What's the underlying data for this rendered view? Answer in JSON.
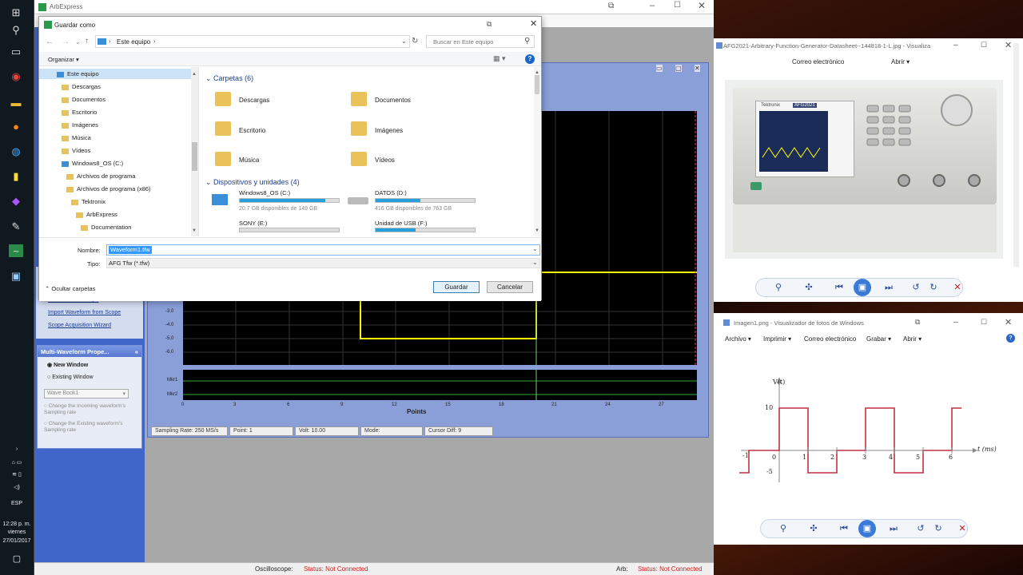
{
  "taskbar": {
    "icons": [
      "windows-icon",
      "search-icon",
      "task-view-icon",
      "chrome-icon",
      "file-explorer-icon",
      "firefox-icon",
      "app-icon",
      "notes-icon",
      "visual-studio-icon",
      "pen-icon",
      "arbexpress-icon",
      "photo-viewer-icon"
    ],
    "tray_lang": "ESP",
    "time": "12:28 p. m.",
    "day": "viernes",
    "date": "27/01/2017"
  },
  "arb": {
    "title": "ArbExpress",
    "links": [
      "Import Waveform from Scope",
      "Scope Acquisition Wizard"
    ],
    "partial_link": "Link an Arb & Scope",
    "mw_panel": {
      "title": "Multi-Waveform Prope...",
      "new_window": "New Window",
      "existing_window": "Existing Window",
      "select_value": "Wave Book1",
      "opt1": "Change the Incoming waveform's Sampling rate",
      "opt2": "Change the Existing waveform's Sampling rate"
    },
    "graph": {
      "x_label": "Points",
      "x_ticks": [
        "0",
        "3",
        "6",
        "9",
        "12",
        "15",
        "18",
        "21",
        "24",
        "27"
      ],
      "y_ticks": [
        "-3.0",
        "-4.0",
        "-5.0",
        "-6.0"
      ],
      "mkr_labels": [
        "Mkr1",
        "Mkr2"
      ]
    },
    "status_fields": [
      "Sampling Rate: 250 MS/s",
      "Point: 1",
      "Volt: 10.00",
      "Mode:",
      "Cursor Diff: 9"
    ],
    "bottom": {
      "osc_label": "Oscilloscope:",
      "osc_status": "Status: Not Connected",
      "arb_label": "Arb:",
      "arb_status": "Status: Not Connected"
    }
  },
  "dialog": {
    "title": "Guardar como",
    "breadcrumb": "Este equipo",
    "search_placeholder": "Buscar en Este equipo",
    "organize": "Organizar",
    "nav": [
      {
        "label": "Este equipo",
        "indent": 0
      },
      {
        "label": "Descargas",
        "indent": 1
      },
      {
        "label": "Documentos",
        "indent": 1
      },
      {
        "label": "Escritorio",
        "indent": 1
      },
      {
        "label": "Imágenes",
        "indent": 1
      },
      {
        "label": "Música",
        "indent": 1
      },
      {
        "label": "Vídeos",
        "indent": 1
      },
      {
        "label": "Windows8_OS (C:)",
        "indent": 1
      },
      {
        "label": "Archivos de programa",
        "indent": 2
      },
      {
        "label": "Archivos de programa (x86)",
        "indent": 2
      },
      {
        "label": "Tektronix",
        "indent": 3
      },
      {
        "label": "ArbExpress",
        "indent": 4
      },
      {
        "label": "Documentation",
        "indent": 5
      }
    ],
    "folders_header": "Carpetas (6)",
    "folders": [
      "Descargas",
      "Documentos",
      "Escritorio",
      "Imágenes",
      "Música",
      "Vídeos"
    ],
    "devices_header": "Dispositivos y unidades (4)",
    "devices": [
      {
        "name": "Windows8_OS (C:)",
        "free": "20.7 GB disponibles de 149 GB",
        "used": 0.86
      },
      {
        "name": "DATOS (D:)",
        "free": "416 GB disponibles de 763 GB",
        "used": 0.45
      },
      {
        "name": "SONY (E:)",
        "free": "",
        "used": 0.0
      },
      {
        "name": "Unidad de USB (F:)",
        "free": "",
        "used": 0.4
      }
    ],
    "name_label": "Nombre:",
    "name_value": "Waveform1.tfw",
    "type_label": "Tipo:",
    "type_value": "AFG Tfw (*.tfw)",
    "hide_folders": "Ocultar carpetas",
    "save": "Guardar",
    "cancel": "Cancelar"
  },
  "viewer1": {
    "title": "AFG2021-Arbitrary-Function-Generator-Datasheet--144818-1-L.jpg - Visualiza...",
    "menu": [
      "Correo electrónico",
      "Abrir"
    ],
    "device_brand": "Tektronix",
    "device_model": "AFG2021"
  },
  "viewer2": {
    "title": "Imagen1.png - Visualizador de fotos de Windows",
    "menu": [
      "Archivo",
      "Imprimir",
      "Correo electrónico",
      "Grabar",
      "Abrir"
    ],
    "plot": {
      "ylabel": "V(t)",
      "xlabel": "t (ms)",
      "y_ticks": [
        "10",
        "-5"
      ],
      "x_ticks": [
        "-1",
        "0",
        "1",
        "2",
        "3",
        "4",
        "5",
        "6"
      ]
    }
  }
}
